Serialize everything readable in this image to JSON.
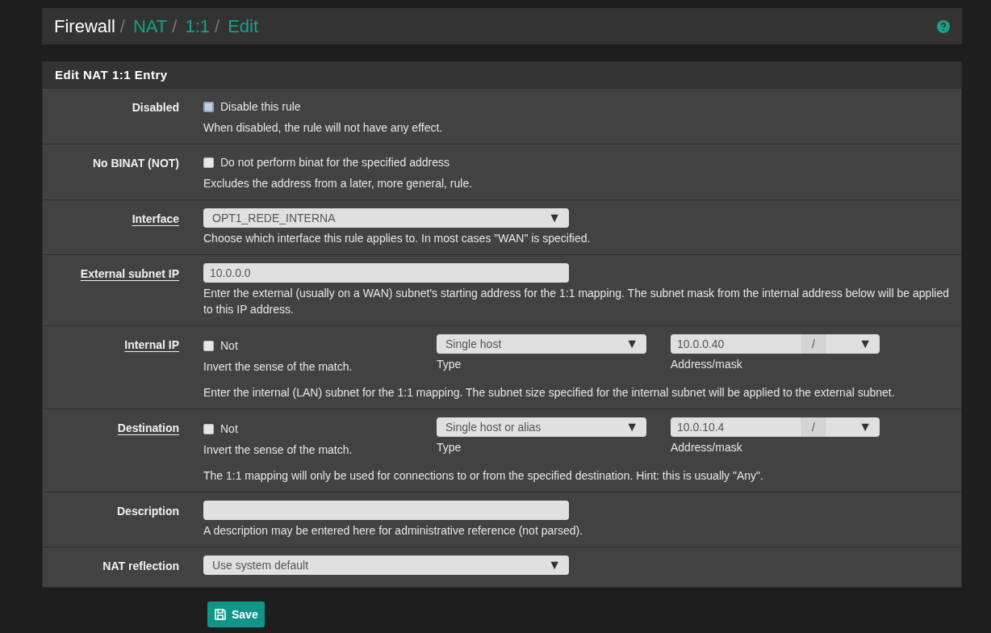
{
  "breadcrumb": [
    {
      "label": "Firewall",
      "link": false,
      "separator": "/"
    },
    {
      "label": "NAT",
      "link": true,
      "separator": "/"
    },
    {
      "label": "1:1",
      "link": true,
      "separator": "/"
    },
    {
      "label": "Edit",
      "link": true
    }
  ],
  "panel": {
    "title": "Edit NAT 1:1 Entry",
    "rows": [
      {
        "kind": "checkbox",
        "label": "Disabled",
        "label_link": false,
        "checkbox": {
          "label": "Disable this rule",
          "checked": false,
          "focused": true
        },
        "help": "When disabled, the rule will not have any effect."
      },
      {
        "kind": "checkbox",
        "label": "No BINAT (NOT)",
        "label_link": false,
        "checkbox": {
          "label": "Do not perform binat for the specified address",
          "checked": false,
          "focused": false
        },
        "help": "Excludes the address from a later, more general, rule."
      },
      {
        "kind": "select",
        "label": "Interface",
        "label_link": true,
        "value": "OPT1_REDE_INTERNA",
        "caret": "▼",
        "help": "Choose which interface this rule applies to. In most cases \"WAN\" is specified."
      },
      {
        "kind": "input",
        "label": "External subnet IP",
        "label_link": true,
        "value": "10.0.0.0",
        "help": "Enter the external (usually on a WAN) subnet's starting address for the 1:1 mapping. The subnet mask from the internal address below will be applied to this IP address."
      },
      {
        "kind": "address",
        "label": "Internal IP",
        "label_link": true,
        "checkbox": {
          "label": "Not",
          "checked": false,
          "focused": false
        },
        "checkbox_help": "Invert the sense of the match.",
        "type": "Single host",
        "type_caret": "▼",
        "type_label": "Type",
        "address": "10.0.0.40",
        "mask_separator": "/",
        "mask_caret": "▼",
        "address_label": "Address/mask",
        "help": "Enter the internal (LAN) subnet for the 1:1 mapping. The subnet size specified for the internal subnet will be applied to the external subnet."
      },
      {
        "kind": "address",
        "label": "Destination",
        "label_link": true,
        "checkbox": {
          "label": "Not",
          "checked": false,
          "focused": false
        },
        "checkbox_help": "Invert the sense of the match.",
        "type": "Single host or alias",
        "type_caret": "▼",
        "type_label": "Type",
        "address": "10.0.10.4",
        "mask_separator": "/",
        "mask_caret": "▼",
        "address_label": "Address/mask",
        "help": "The 1:1 mapping will only be used for connections to or from the specified destination. Hint: this is usually \"Any\"."
      },
      {
        "kind": "input",
        "label": "Description",
        "label_link": false,
        "help": "A description may be entered here for administrative reference (not parsed)."
      },
      {
        "kind": "select",
        "label": "NAT reflection",
        "label_link": false,
        "value": "Use system default",
        "caret": "▼"
      }
    ]
  },
  "save_button": {
    "label": "Save"
  }
}
